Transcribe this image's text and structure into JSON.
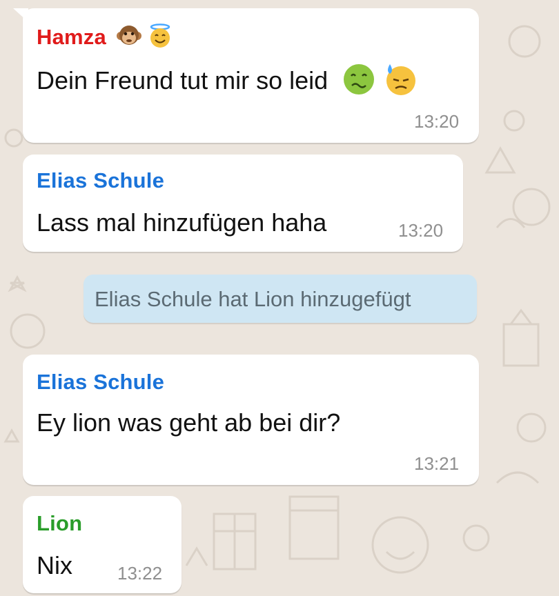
{
  "colors": {
    "background": "#ece5dd",
    "bubble": "#ffffff",
    "system_bubble": "#cfe6f3",
    "sender_hamza": "#e01b1b",
    "sender_elias": "#1a73d9",
    "sender_lion": "#2a9d2a",
    "timestamp": "#8f8f8f"
  },
  "messages": [
    {
      "sender": "Hamza",
      "sender_emojis": [
        "monkey-face-icon",
        "smiling-face-with-halo-icon"
      ],
      "text": "Dein Freund tut mir so leid",
      "text_emojis": [
        "nauseated-face-icon",
        "downcast-face-with-sweat-icon"
      ],
      "time": "13:20"
    },
    {
      "sender": "Elias Schule",
      "text": "Lass mal hinzufügen haha",
      "time": "13:20"
    },
    {
      "system": true,
      "text": "Elias Schule hat Lion hinzugefügt"
    },
    {
      "sender": "Elias Schule",
      "text": "Ey lion was geht ab bei dir?",
      "time": "13:21"
    },
    {
      "sender": "Lion",
      "text": "Nix",
      "time": "13:22"
    }
  ]
}
